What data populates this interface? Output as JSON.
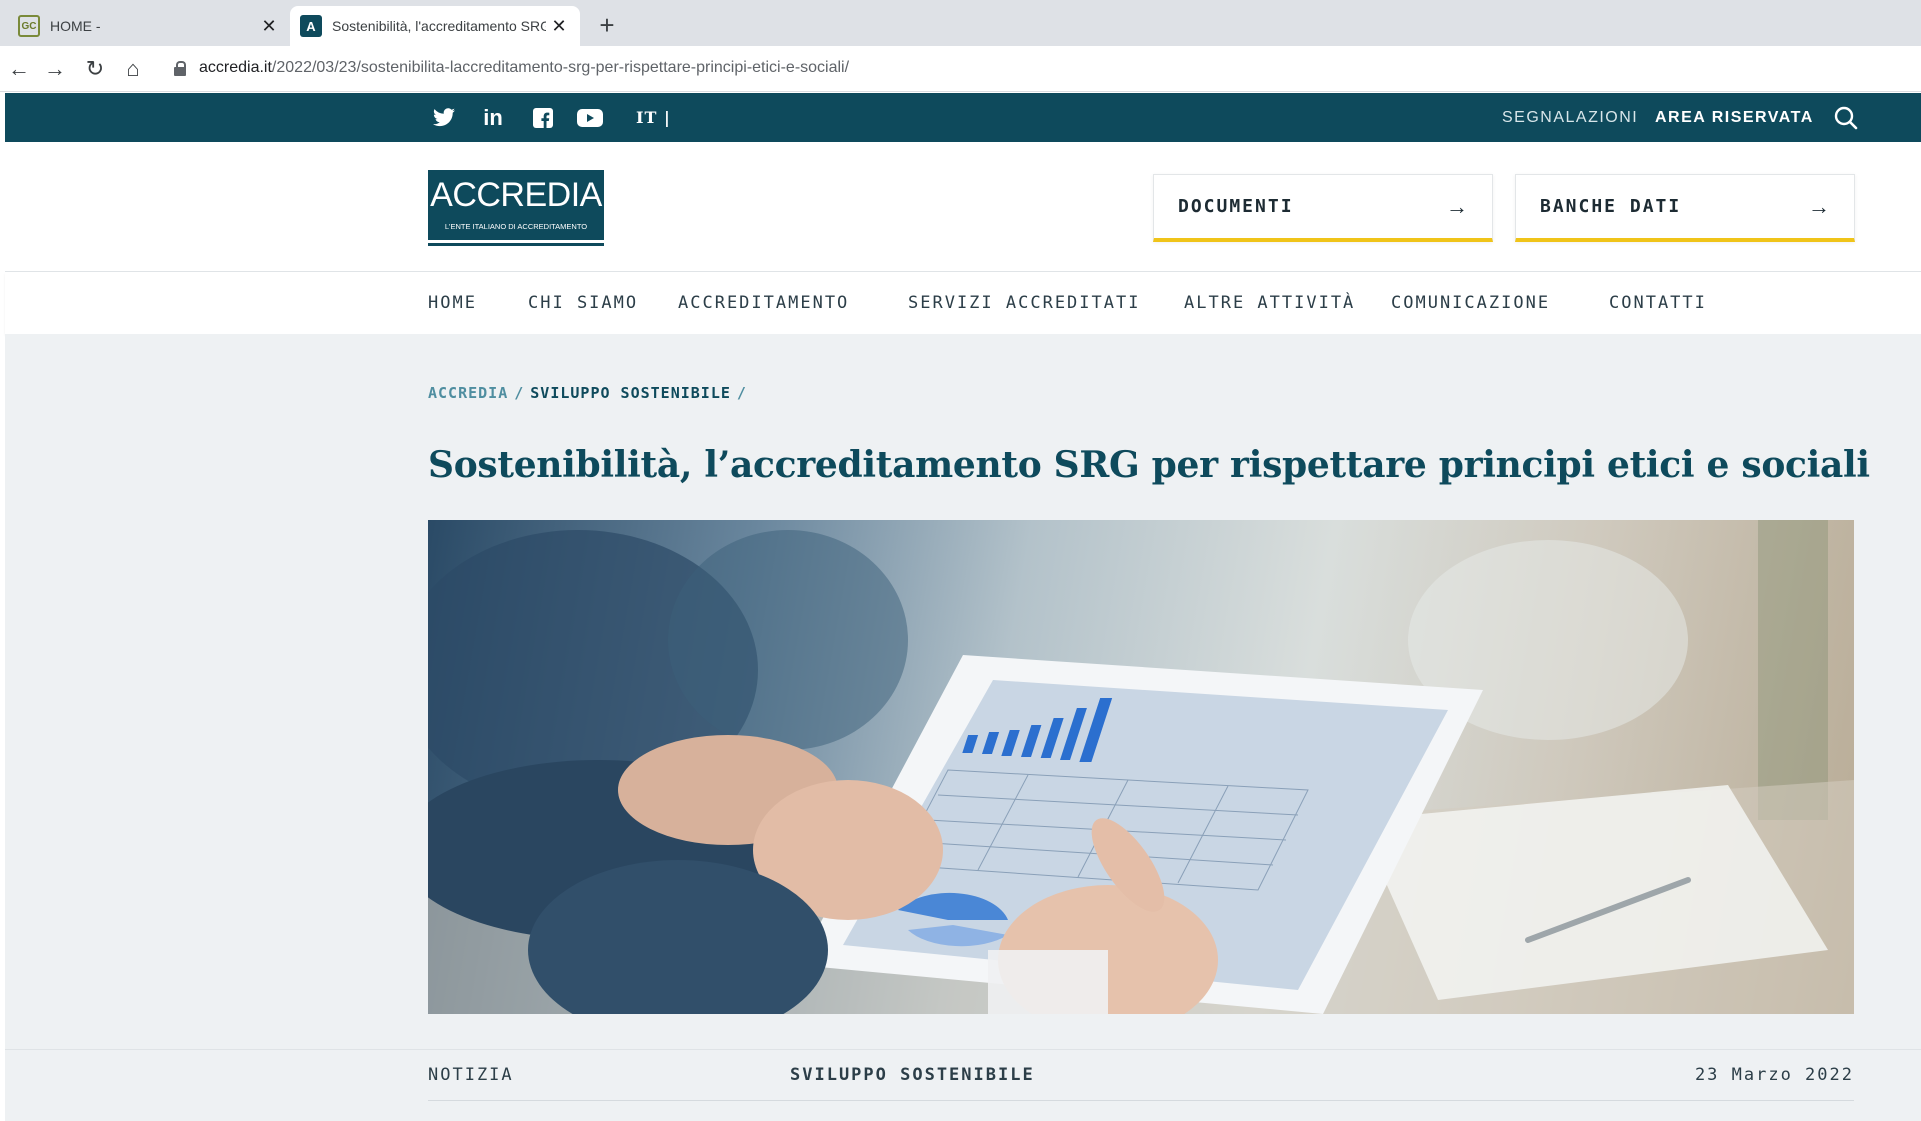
{
  "browser": {
    "tabs": [
      {
        "title": "HOME -",
        "favicon": "site-favicon",
        "active": false
      },
      {
        "title": "Sostenibilità, l'accreditamento SRG",
        "favicon": "accredia-favicon",
        "active": true
      }
    ],
    "url": {
      "domain": "accredia.it",
      "path": "/2022/03/23/sostenibilita-laccreditamento-srg-per-rispettare-principi-etici-e-sociali/"
    }
  },
  "topbar": {
    "social": [
      "twitter-icon",
      "linkedin-icon",
      "facebook-icon",
      "youtube-icon"
    ],
    "linkedin_text": "in",
    "language": "IT |",
    "segnalazioni": "SEGNALAZIONI",
    "area_riservata": "AREA RISERVATA"
  },
  "header": {
    "logo": {
      "word": "ACCREDIA",
      "subtitle": "L'ENTE ITALIANO DI ACCREDITAMENTO"
    },
    "buttons": [
      {
        "label": "DOCUMENTI",
        "arrow": "→"
      },
      {
        "label": "BANCHE DATI",
        "arrow": "→"
      }
    ]
  },
  "nav": {
    "items": [
      "HOME",
      "CHI SIAMO",
      "ACCREDITAMENTO",
      "SERVIZI ACCREDITATI",
      "ALTRE ATTIVITÀ",
      "COMUNICAZIONE",
      "CONTATTI"
    ]
  },
  "article": {
    "breadcrumb": {
      "root": "ACCREDIA",
      "section": "SVILUPPO SOSTENIBILE",
      "sep": "/"
    },
    "title": "Sostenibilità, l’accreditamento SRG per rispettare principi etici e sociali",
    "meta": {
      "type": "NOTIZIA",
      "category": "SVILUPPO SOSTENIBILE",
      "date": "23 Marzo 2022"
    }
  },
  "colors": {
    "brand": "#0e4a5c",
    "accent_yellow": "#f0c419",
    "content_bg": "#eef1f3"
  }
}
